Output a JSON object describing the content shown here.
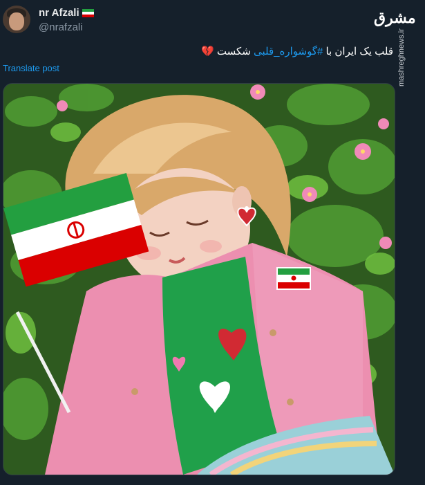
{
  "post": {
    "display_name": "nr Afzali",
    "handle": "@nrafzali",
    "text_prefix": "قلب یک ایران با ",
    "hashtag": "#گوشواره_قلبی",
    "text_suffix": " شکست",
    "broken_heart_emoji": "💔",
    "translate_label": "Translate post"
  },
  "watermark": {
    "logo_text": "مشرق",
    "site": "mashreghnews.ir"
  },
  "image": {
    "subject": "girl-with-heart-earring-and-flag",
    "flag_colors": {
      "green": "#239f40",
      "white": "#ffffff",
      "red": "#da0000"
    },
    "accent_colors": {
      "jacket": "#ec8fb0",
      "shirt": "#20a04a",
      "hair": "#d9a86a"
    }
  }
}
